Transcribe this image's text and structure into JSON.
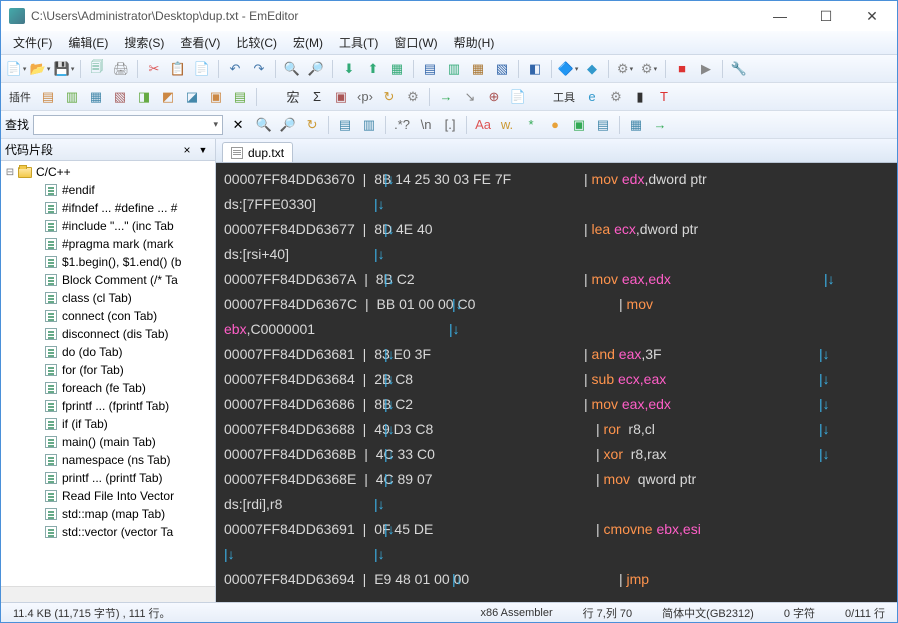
{
  "titlebar": {
    "path": "C:\\Users\\Administrator\\Desktop\\dup.txt - EmEditor"
  },
  "menus": [
    "文件(F)",
    "编辑(E)",
    "搜索(S)",
    "查看(V)",
    "比较(C)",
    "宏(M)",
    "工具(T)",
    "窗口(W)",
    "帮助(H)"
  ],
  "toolbar2_label_left": "插件",
  "toolbar2_label_right": "工具",
  "search_label": "查找",
  "sidebar": {
    "title": "代码片段",
    "root": "C/C++",
    "items": [
      "#endif",
      "#ifndef ... #define ... #",
      "#include \"...\"  (inc Tab",
      "#pragma mark  (mark",
      "$1.begin(), $1.end()  (b",
      "Block Comment  (/* Ta",
      "class  (cl Tab)",
      "connect  (con Tab)",
      "disconnect  (dis Tab)",
      "do  (do Tab)",
      "for  (for Tab)",
      "foreach  (fe Tab)",
      "fprintf ...  (fprintf Tab)",
      "if  (if Tab)",
      "main()  (main Tab)",
      "namespace  (ns Tab)",
      "printf ...  (printf Tab)",
      "Read File Into Vector",
      "std::map  (map Tab)",
      "std::vector  (vector Ta"
    ]
  },
  "tab": {
    "filename": "dup.txt"
  },
  "asm_lines": [
    {
      "addr": "00007FF84DD63670",
      "bytes": "8B 14 25 30 03 FE 7F",
      "op": "mov",
      "args_reg": "edx",
      "args_tail": ",dword ptr",
      "wrap": "ds:[7FFE0330]",
      "p1": 385,
      "p2": 585,
      "p3": null
    },
    {
      "addr": "00007FF84DD63677",
      "bytes": "8D 4E 40",
      "op": "lea",
      "args_reg": "ecx",
      "args_tail": ",dword ptr",
      "wrap": "ds:[rsi+40]",
      "p1": 385,
      "p2": 585,
      "p3": null
    },
    {
      "addr": "00007FF84DD6367A",
      "bytes": "8B C2",
      "op": "mov",
      "args_reg": "eax,edx",
      "args_tail": "",
      "wrap": null,
      "p1": 385,
      "p2": 585,
      "p3": 825
    },
    {
      "addr": "00007FF84DD6367C",
      "bytes": "BB 01 00 00 C0",
      "op": "mov",
      "args_reg": "",
      "args_tail": "",
      "wrap_reg": "ebx",
      "wrap_tail": ",C0000001",
      "p1": 453,
      "p2": 620,
      "p3": null
    },
    {
      "addr": "00007FF84DD63681",
      "bytes": "83 E0 3F",
      "op": "and",
      "args_reg": "eax",
      "args_tail": ",3F",
      "wrap": null,
      "p1": 385,
      "p2": 585,
      "p3": 820
    },
    {
      "addr": "00007FF84DD63684",
      "bytes": "2B C8",
      "op": "sub",
      "args_reg": "ecx,eax",
      "args_tail": "",
      "wrap": null,
      "p1": 385,
      "p2": 585,
      "p3": 820
    },
    {
      "addr": "00007FF84DD63686",
      "bytes": "8B C2",
      "op": "mov",
      "args_reg": "eax,edx",
      "args_tail": "",
      "wrap": null,
      "p1": 385,
      "p2": 585,
      "p3": 820
    },
    {
      "addr": "00007FF84DD63688",
      "bytes": "49 D3 C8",
      "op": "ror",
      "args_reg": "",
      "args_tail": " r8,cl",
      "wrap": null,
      "p1": 385,
      "p2": 597,
      "p3": 820
    },
    {
      "addr": "00007FF84DD6368B",
      "bytes": "4C 33 C0",
      "op": "xor",
      "args_reg": "",
      "args_tail": " r8,rax",
      "wrap": null,
      "p1": 385,
      "p2": 597,
      "p3": 820
    },
    {
      "addr": "00007FF84DD6368E",
      "bytes": "4C 89 07",
      "op": "mov",
      "args_reg": "",
      "args_tail": " qword ptr",
      "wrap": "ds:[rdi],r8",
      "p1": 385,
      "p2": 597,
      "p3": null
    },
    {
      "addr": "00007FF84DD63691",
      "bytes": "0F 45 DE",
      "op": "cmovne",
      "args_reg": "ebx,esi",
      "args_tail": "",
      "wrap": "",
      "p1": 385,
      "p2": 597,
      "p3": null,
      "wrap_is_arrow": true
    },
    {
      "addr": "00007FF84DD63694",
      "bytes": "E9 48 01 00 00",
      "op": "jmp",
      "args_reg": "",
      "args_tail": "",
      "wrap": null,
      "p1": 453,
      "p2": 620,
      "p3": null
    }
  ],
  "statusbar": {
    "left": "11.4 KB (11,715 字节) , 111 行。",
    "lang": "x86 Assembler",
    "pos": "行 7,列 70",
    "enc": "简体中文(GB2312)",
    "sel": "0 字符",
    "lines": "0/111 行"
  }
}
